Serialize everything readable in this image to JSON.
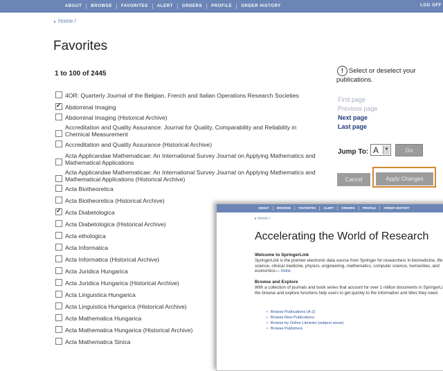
{
  "nav": {
    "items": [
      "ABOUT",
      "BROWSE",
      "FAVORITES",
      "ALERT",
      "ORDERS",
      "PROFILE",
      "ORDER HISTORY"
    ],
    "logoff": "LOG OFF"
  },
  "breadcrumb": "Home /",
  "page_title": "Favorites",
  "range_text": "1 to 100 of 2445",
  "info_icon": "!",
  "info_text": "Select or deselect your publications.",
  "pagination": {
    "first": "First page",
    "previous": "Previous page",
    "next": "Next page",
    "last": "Last page"
  },
  "jump": {
    "label": "Jump To:",
    "value": "A",
    "arrow": "▼",
    "go": "Go"
  },
  "buttons": {
    "cancel": "Cancel",
    "apply": "Apply Changes"
  },
  "publications": [
    {
      "title": "4OR: Quarterly Journal of the Belgian, French and Italian Operations Research Societies",
      "checked": false
    },
    {
      "title": "Abdominal Imaging",
      "checked": true
    },
    {
      "title": "Abdominal Imaging (Historical Archive)",
      "checked": false
    },
    {
      "title": "Accreditation and Quality Assurance: Journal for Quality, Comparability and Reliability in Chemical Measurement",
      "checked": false
    },
    {
      "title": "Accreditation and Quality Assurance (Historical Archive)",
      "checked": false
    },
    {
      "title": "Acta Applicandae Mathematicae: An International Survey Journal on Applying Mathematics and Mathematical Applications",
      "checked": false
    },
    {
      "title": "Acta Applicandae Mathematicae: An International Survey Journal on Applying Mathematics and Mathematical Applications (Historical Archive)",
      "checked": false
    },
    {
      "title": "Acta Biotheoretica",
      "checked": false
    },
    {
      "title": "Acta Biotheoretica (Historical Archive)",
      "checked": false
    },
    {
      "title": "Acta Diabetologica",
      "checked": true
    },
    {
      "title": "Acta Diabetologica (Historical Archive)",
      "checked": false
    },
    {
      "title": "Acta ethologica",
      "checked": false
    },
    {
      "title": "Acta Informatica",
      "checked": false
    },
    {
      "title": "Acta Informatica (Historical Archive)",
      "checked": false
    },
    {
      "title": "Acta Juridica Hungarica",
      "checked": false
    },
    {
      "title": "Acta Juridica Hungarica (Historical Archive)",
      "checked": false
    },
    {
      "title": "Acta Linguistica Hungarica",
      "checked": false
    },
    {
      "title": "Acta Linguistica Hungarica (Historical Archive)",
      "checked": false
    },
    {
      "title": "Acta Mathematica Hungarica",
      "checked": false
    },
    {
      "title": "Acta Mathematica Hungarica (Historical Archive)",
      "checked": false
    },
    {
      "title": "Acta Mathematica Sinica",
      "checked": false
    }
  ],
  "inset": {
    "nav": [
      "ABOUT",
      "BROWSE",
      "FAVORITES",
      "ALERT",
      "ORDERS",
      "PROFILE",
      "ORDER HISTORY"
    ],
    "breadcrumb": "Home /",
    "title": "Accelerating the World of Research",
    "welcome_heading": "Welcome to SpringerLink",
    "welcome_text": "SpringerLink is the premier electronic data source from Springer for researchers in biomedicine, life science, clinical medicine, physics, engineering, mathematics, computer science, humanities, and economics—",
    "more": "more.",
    "browse_heading": "Browse and Explore",
    "browse_text": "With a collection of journals and book series that account for over 1 million documents in SpringerLink, the browse and explore functions help users to get quickly to the information and titles they need.",
    "links": [
      "Browse Publications (A-Z)",
      "Browse New Publications",
      "Browse by Online Libraries (subject areas)",
      "Browse Publishers"
    ]
  }
}
